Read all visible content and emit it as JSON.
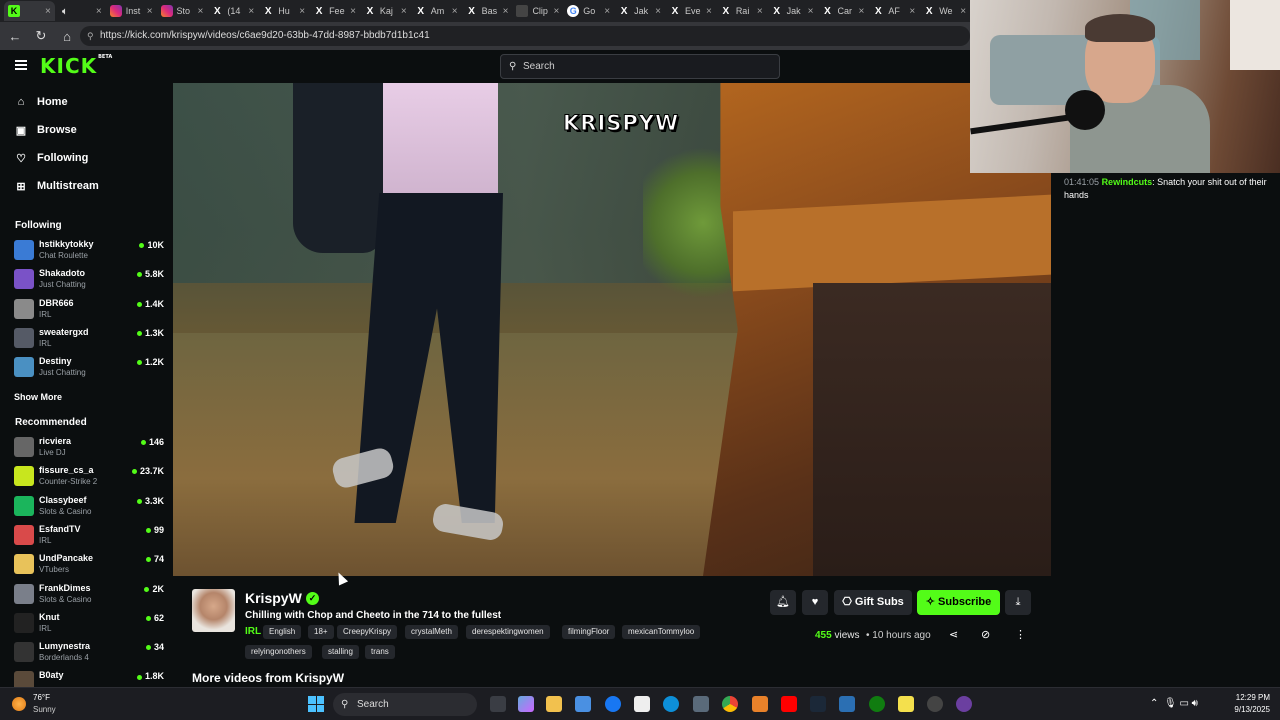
{
  "browser": {
    "tabs": [
      {
        "label": "",
        "icon": "kick-favicon",
        "active": true
      },
      {
        "label": "",
        "icon": "speaker-icon"
      },
      {
        "label": "Inst",
        "icon": "instagram-favicon"
      },
      {
        "label": "Sto",
        "icon": "instagram-favicon"
      },
      {
        "label": "(14",
        "icon": "x-favicon"
      },
      {
        "label": "Hu",
        "icon": "x-favicon"
      },
      {
        "label": "Fee",
        "icon": "x-favicon"
      },
      {
        "label": "Kaj",
        "icon": "x-favicon"
      },
      {
        "label": "Am",
        "icon": "x-favicon"
      },
      {
        "label": "Bas",
        "icon": "x-favicon"
      },
      {
        "label": "Clip",
        "icon": "clip-favicon"
      },
      {
        "label": "Go",
        "icon": "google-favicon"
      },
      {
        "label": "Jak",
        "icon": "x-favicon"
      },
      {
        "label": "Eve",
        "icon": "x-favicon"
      },
      {
        "label": "Rai",
        "icon": "x-favicon"
      },
      {
        "label": "Jak",
        "icon": "x-favicon"
      },
      {
        "label": "Car",
        "icon": "x-favicon"
      },
      {
        "label": "AF",
        "icon": "x-favicon"
      },
      {
        "label": "We",
        "icon": "x-favicon"
      }
    ],
    "url": "https://kick.com/krispyw/videos/c6ae9d20-63bb-47dd-8987-bbdb7d1b1c41"
  },
  "header": {
    "logo": "KICK",
    "logo_badge": "BETA",
    "search_placeholder": "Search"
  },
  "sidebar": {
    "nav": [
      {
        "label": "Home",
        "icon": "home-icon"
      },
      {
        "label": "Browse",
        "icon": "browse-icon"
      },
      {
        "label": "Following",
        "icon": "heart-icon"
      },
      {
        "label": "Multistream",
        "icon": "grid-icon"
      }
    ],
    "following_heading": "Following",
    "following": [
      {
        "name": "hstikkytokky",
        "category": "Chat Roulette",
        "viewers": "10K",
        "color": "#3a7bd5"
      },
      {
        "name": "Shakadoto",
        "category": "Just Chatting",
        "viewers": "5.8K",
        "color": "#7a52c7"
      },
      {
        "name": "DBR666",
        "category": "IRL",
        "viewers": "1.4K",
        "color": "#8a8a8a"
      },
      {
        "name": "sweatergxd",
        "category": "IRL",
        "viewers": "1.3K",
        "color": "#555a66"
      },
      {
        "name": "Destiny",
        "category": "Just Chatting",
        "viewers": "1.2K",
        "color": "#4a90c2"
      }
    ],
    "show_more": "Show More",
    "recommended_heading": "Recommended",
    "recommended": [
      {
        "name": "ricviera",
        "category": "Live DJ",
        "viewers": "146",
        "color": "#666"
      },
      {
        "name": "fissure_cs_a",
        "category": "Counter-Strike 2",
        "viewers": "23.7K",
        "color": "#c8e61e"
      },
      {
        "name": "Classybeef",
        "category": "Slots & Casino",
        "viewers": "3.3K",
        "color": "#1bb55c"
      },
      {
        "name": "EsfandTV",
        "category": "IRL",
        "viewers": "99",
        "color": "#d94a4a"
      },
      {
        "name": "UndPancake",
        "category": "VTubers",
        "viewers": "74",
        "color": "#e8c25a"
      },
      {
        "name": "FrankDimes",
        "category": "Slots & Casino",
        "viewers": "2K",
        "color": "#7a7f8a"
      },
      {
        "name": "Knut",
        "category": "IRL",
        "viewers": "62",
        "color": "#222"
      },
      {
        "name": "Lumynestra",
        "category": "Borderlands 4",
        "viewers": "34",
        "color": "#333"
      },
      {
        "name": "B0aty",
        "category": "",
        "viewers": "1.8K",
        "color": "#5a4a3a"
      }
    ]
  },
  "video": {
    "watermark": "KRISPYW"
  },
  "chat": {
    "messages": [
      {
        "timestamp": "01:41:05",
        "user": "Rewindcuts",
        "text": "Snatch your shit out of their hands"
      }
    ]
  },
  "info": {
    "streamer": "KrispyW",
    "title": "Chilling with Chop and Cheeto in the 714 to the fullest",
    "category": "IRL",
    "tags": [
      "English",
      "18+",
      "CreepyKrispy",
      "crystalMeth",
      "derespektingwomen",
      "filmingFloor",
      "mexicanTommyloo",
      "relyingonothers",
      "stalling",
      "trans"
    ],
    "gift_subs": "Gift Subs",
    "subscribe": "Subscribe",
    "views_count": "455",
    "views_label": "views",
    "time_ago": "10 hours ago",
    "more_videos": "More videos from KrispyW"
  },
  "taskbar": {
    "temperature": "76°F",
    "condition": "Sunny",
    "search": "Search",
    "time": "12:29 PM",
    "date": "9/13/2025"
  },
  "colors": {
    "kick_green": "#53fc18",
    "background": "#0b0e0f"
  }
}
